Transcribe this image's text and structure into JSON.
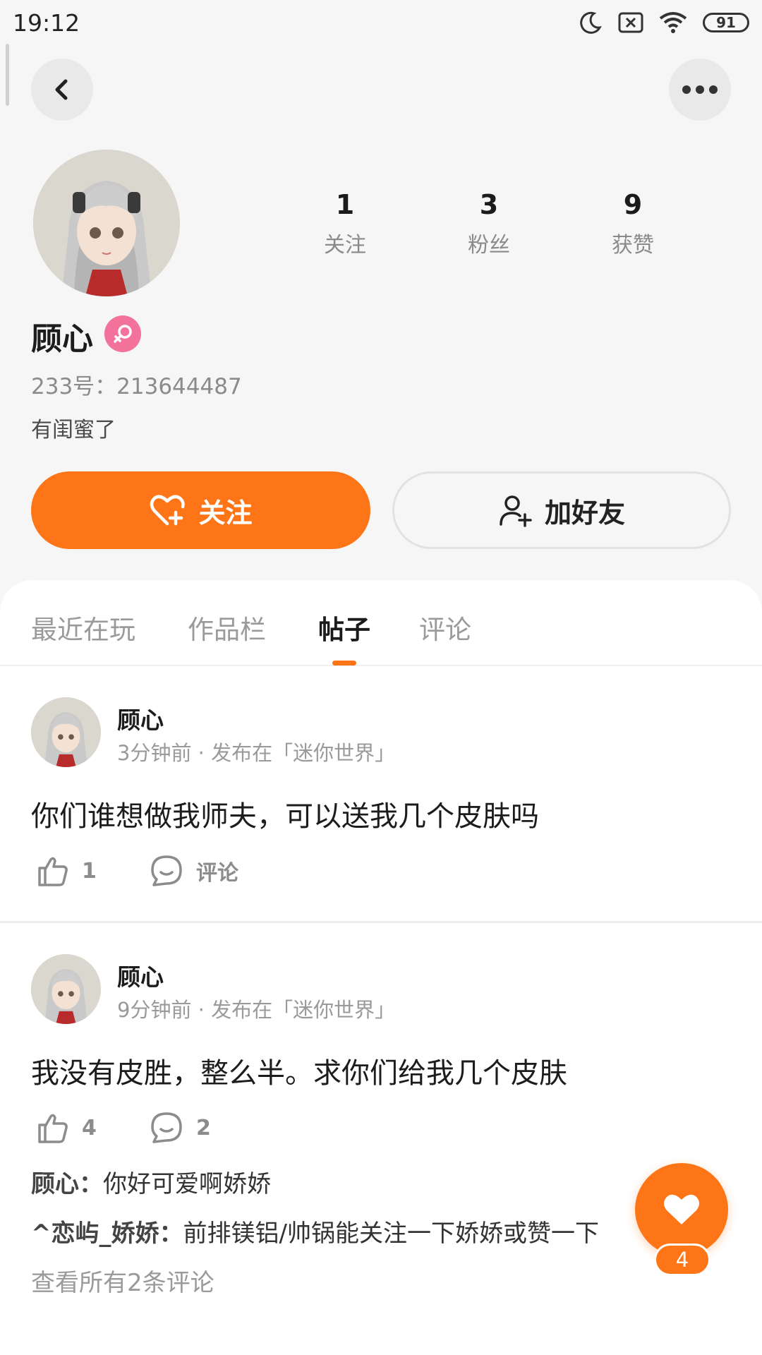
{
  "status_bar": {
    "time": "19:12",
    "battery": "91"
  },
  "profile": {
    "stats": [
      {
        "value": "1",
        "label": "关注"
      },
      {
        "value": "3",
        "label": "粉丝"
      },
      {
        "value": "9",
        "label": "获赞"
      }
    ],
    "name": "顾心",
    "uid": "233号：213644487",
    "bio": "有闺蜜了",
    "follow_label": "关注",
    "add_friend_label": "加好友"
  },
  "tabs": [
    {
      "label": "最近在玩"
    },
    {
      "label": "作品栏"
    },
    {
      "label": "帖子"
    },
    {
      "label": "评论"
    }
  ],
  "posts": [
    {
      "author": "顾心",
      "meta": "3分钟前 · 发布在「迷你世界」",
      "text": "你们谁想做我师夫，可以送我几个皮肤吗",
      "likes": "1",
      "comment_label": "评论"
    },
    {
      "author": "顾心",
      "meta": "9分钟前 · 发布在「迷你世界」",
      "text": "我没有皮胜，整么半。求你们给我几个皮肤",
      "likes": "4",
      "comment_label": "2",
      "comments": [
        {
          "user": "顾心：",
          "text": "你好可爱啊娇娇"
        },
        {
          "user": "^恋屿_娇娇：",
          "text": "前排镁铝/帅锅能关注一下娇娇或赞一下"
        }
      ],
      "view_all": "查看所有2条评论"
    }
  ],
  "fab": {
    "count": "4"
  },
  "colors": {
    "accent": "#fd7516",
    "gender_badge": "#f2729b"
  }
}
